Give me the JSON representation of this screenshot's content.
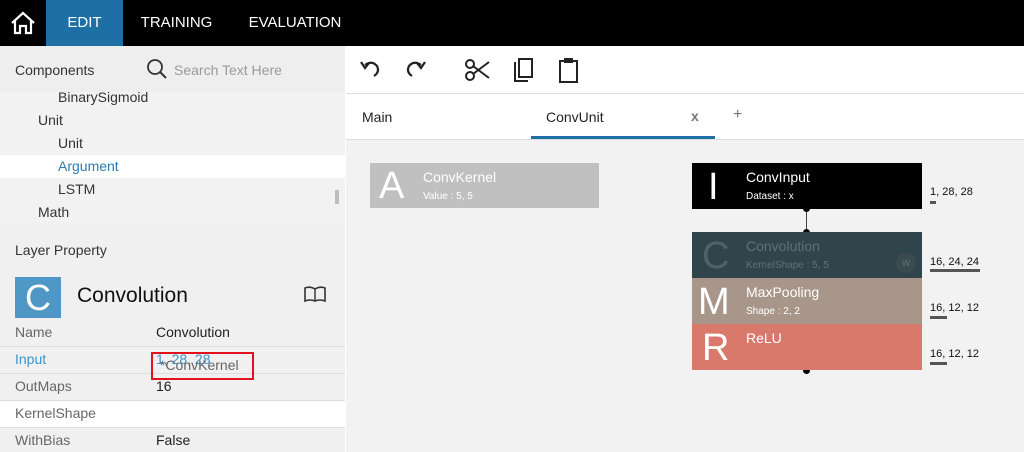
{
  "nav": {
    "home_icon": "home-icon",
    "tabs": [
      "EDIT",
      "TRAINING",
      "EVALUATION"
    ],
    "active_tab": "EDIT",
    "active_color": "#1e6fa5"
  },
  "components": {
    "title": "Components",
    "search_placeholder": "Search Text Here",
    "tree": [
      {
        "label": "BinarySigmoid",
        "level": 2
      },
      {
        "label": "Unit",
        "level": 1
      },
      {
        "label": "Unit",
        "level": 2
      },
      {
        "label": "Argument",
        "level": 2,
        "selected": true
      },
      {
        "label": "LSTM",
        "level": 2
      },
      {
        "label": "Math",
        "level": 1
      }
    ]
  },
  "layer_property": {
    "title": "Layer Property",
    "icon_letter": "C",
    "icon_color": "#4f97c7",
    "layer_name": "Convolution",
    "properties": [
      {
        "key": "Name",
        "value": "Convolution"
      },
      {
        "key": "Input",
        "value": "1, 28, 28"
      },
      {
        "key": "OutMaps",
        "value": "16"
      },
      {
        "key": "KernelShape",
        "value": "*ConvKernel"
      },
      {
        "key": "WithBias",
        "value": "False"
      }
    ]
  },
  "toolbar": {
    "icons": [
      "undo-icon",
      "redo-icon",
      "cut-icon",
      "copy-icon",
      "paste-icon"
    ]
  },
  "doc_tabs": {
    "tabs": [
      "Main",
      "ConvUnit"
    ],
    "active": "ConvUnit",
    "close_label": "x",
    "add_label": "+"
  },
  "canvas": {
    "nodes": [
      {
        "id": "convkernel",
        "letter": "A",
        "name": "ConvKernel",
        "sub": "Value : 5, 5",
        "color": "#c0c0c0"
      },
      {
        "id": "convinput",
        "letter": "I",
        "name": "ConvInput",
        "sub": "Dataset : x",
        "color": "#000000",
        "shape": "1, 28, 28"
      },
      {
        "id": "convolution",
        "letter": "C",
        "name": "Convolution",
        "sub": "KernelShape : 5, 5",
        "color": "#2f444b",
        "shape": "16, 24, 24",
        "badge": "W"
      },
      {
        "id": "maxpooling",
        "letter": "M",
        "name": "MaxPooling",
        "sub": "Shape : 2, 2",
        "color": "#a8968a",
        "shape": "16, 12, 12"
      },
      {
        "id": "relu",
        "letter": "R",
        "name": "ReLU",
        "sub": "",
        "color": "#d9796c",
        "shape": "16, 12, 12"
      }
    ]
  }
}
